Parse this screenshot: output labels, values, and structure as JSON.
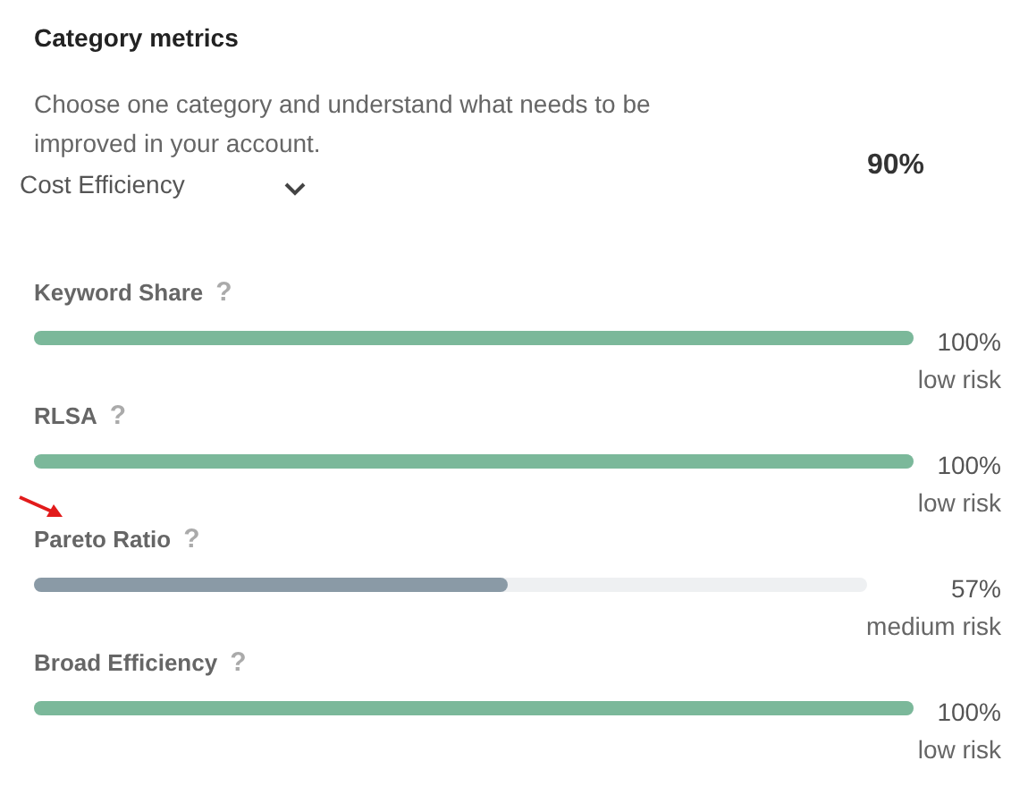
{
  "title": "Category metrics",
  "description": "Choose one category and understand what needs to be improved in your account.",
  "category_select": {
    "value": "Cost Efficiency"
  },
  "overall_score": "90%",
  "metrics": [
    {
      "name": "Keyword Share",
      "help": "?",
      "level": 1,
      "color": "#7bb89a",
      "reading": "100%",
      "risk": "low risk"
    },
    {
      "name": "RLSA",
      "help": "?",
      "level": 1,
      "color": "#7bb89a",
      "reading": "100%",
      "risk": "low risk"
    },
    {
      "name": "Pareto Ratio",
      "help": "?",
      "level": 0.57,
      "color": "#8a9aa6",
      "reading": "57%",
      "risk": "medium risk"
    },
    {
      "name": "Broad Efficiency",
      "help": "?",
      "level": 1,
      "color": "#7bb89a",
      "reading": "100%",
      "risk": "low risk"
    }
  ]
}
